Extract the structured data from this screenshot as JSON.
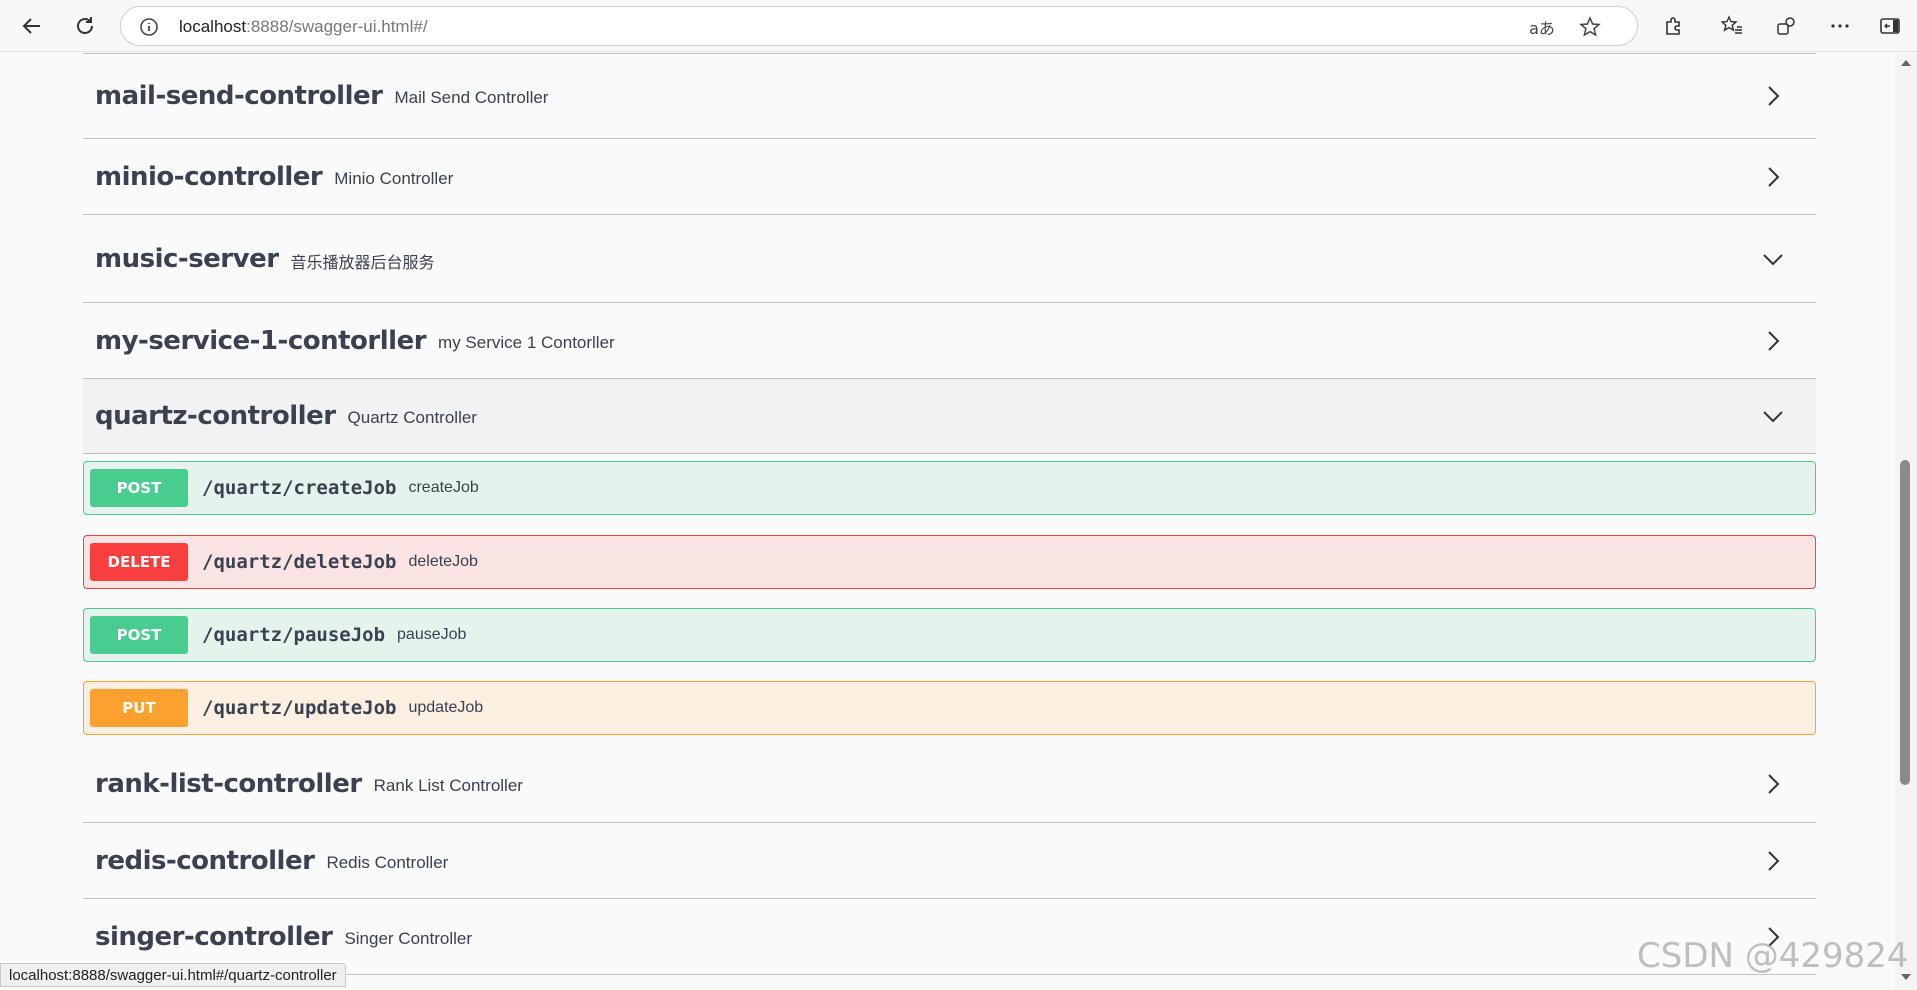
{
  "browser": {
    "url_host": "localhost",
    "url_rest": ":8888/swagger-ui.html#/",
    "status_text": "localhost:8888/swagger-ui.html#/quartz-controller"
  },
  "tags": [
    {
      "name": "mail-send-controller",
      "description": "Mail Send Controller",
      "state": "collapsed"
    },
    {
      "name": "minio-controller",
      "description": "Minio Controller",
      "state": "collapsed"
    },
    {
      "name": "music-server",
      "description": "音乐播放器后台服务",
      "state": "expanded"
    },
    {
      "name": "my-service-1-contorller",
      "description": "my Service 1 Contorller",
      "state": "collapsed"
    },
    {
      "name": "quartz-controller",
      "description": "Quartz Controller",
      "state": "expanded"
    },
    {
      "name": "rank-list-controller",
      "description": "Rank List Controller",
      "state": "collapsed"
    },
    {
      "name": "redis-controller",
      "description": "Redis Controller",
      "state": "collapsed"
    },
    {
      "name": "singer-controller",
      "description": "Singer Controller",
      "state": "collapsed"
    }
  ],
  "operations": [
    {
      "method": "POST",
      "path": "/quartz/createJob",
      "summary": "createJob"
    },
    {
      "method": "DELETE",
      "path": "/quartz/deleteJob",
      "summary": "deleteJob"
    },
    {
      "method": "POST",
      "path": "/quartz/pauseJob",
      "summary": "pauseJob"
    },
    {
      "method": "PUT",
      "path": "/quartz/updateJob",
      "summary": "updateJob"
    }
  ],
  "colors": {
    "post": "#49cc90",
    "delete": "#f93e3e",
    "put": "#fca130",
    "text": "#3b4151"
  },
  "watermark": "CSDN @429824"
}
